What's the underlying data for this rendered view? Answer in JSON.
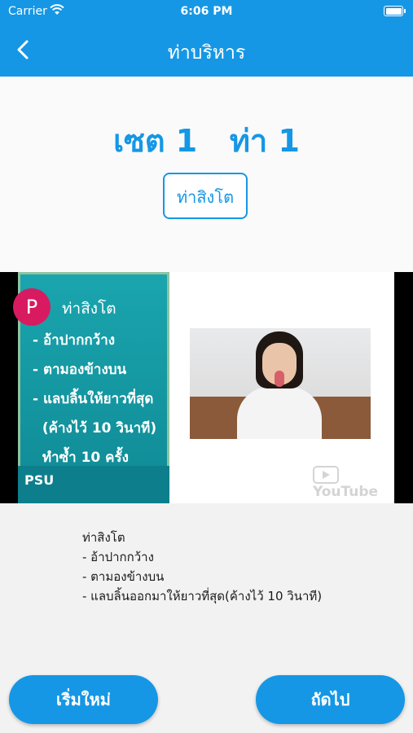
{
  "status_bar": {
    "carrier": "Carrier",
    "time": "6:06 PM"
  },
  "nav": {
    "title": "ท่าบริหาร"
  },
  "exercise": {
    "heading": "เซต 1   ท่า 1",
    "pose_button": "ท่าสิงโต"
  },
  "video": {
    "avatar_letter": "P",
    "title": "ท่าสิงโต",
    "slide_items": [
      "- อ้าปากกว้าง",
      "- ตามองข้างบน",
      "- แลบลิ้นให้ยาวที่สุด",
      "  (ค้างไว้ 10 วินาที)",
      "  ทำซ้ำ 10 ครั้ง"
    ],
    "logo": "PSU",
    "watermark": "YouTube"
  },
  "description": {
    "lines": [
      "ท่าสิงโต",
      "- อ้าปากกว้าง",
      "- ตามองข้างบน",
      "- แลบลิ้นออกมาให้ยาวที่สุด(ค้างไว้ 10 วินาที)"
    ]
  },
  "buttons": {
    "restart": "เริ่มใหม่",
    "next": "ถัดไป"
  },
  "colors": {
    "primary": "#1597e5",
    "background": "#f2f2f2",
    "avatar": "#d81b60"
  }
}
